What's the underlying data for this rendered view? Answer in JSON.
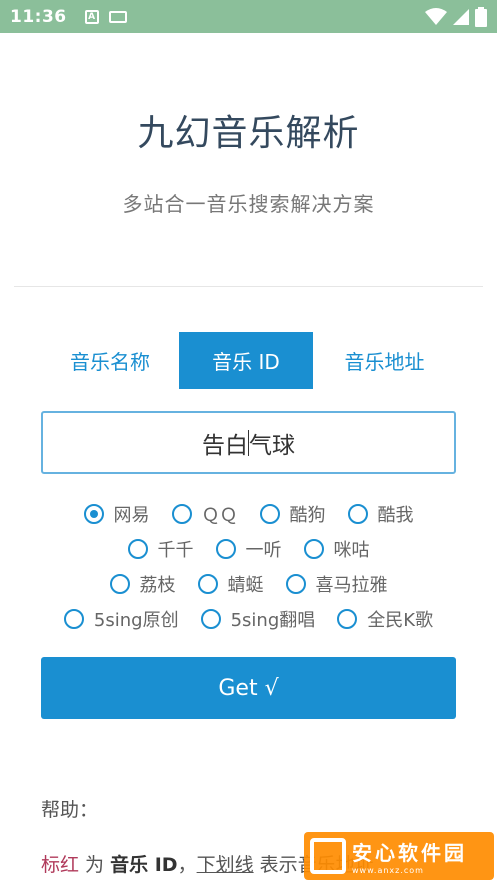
{
  "status_bar": {
    "time": "11:36",
    "a_icon": "A"
  },
  "header": {
    "title": "九幻音乐解析",
    "subtitle": "多站合一音乐搜索解决方案"
  },
  "tabs": [
    {
      "label": "音乐名称",
      "active": false
    },
    {
      "label": "音乐 ID",
      "active": true
    },
    {
      "label": "音乐地址",
      "active": false
    }
  ],
  "search": {
    "value_before_caret": "告白",
    "value_after_caret": "气球"
  },
  "sources": [
    {
      "label": "网易",
      "checked": true
    },
    {
      "label": "ＱＱ",
      "checked": false
    },
    {
      "label": "酷狗",
      "checked": false
    },
    {
      "label": "酷我",
      "checked": false
    },
    {
      "label": "千千",
      "checked": false
    },
    {
      "label": "一听",
      "checked": false
    },
    {
      "label": "咪咕",
      "checked": false
    },
    {
      "label": "荔枝",
      "checked": false
    },
    {
      "label": "蜻蜓",
      "checked": false
    },
    {
      "label": "喜马拉雅",
      "checked": false
    },
    {
      "label": "5sing原创",
      "checked": false
    },
    {
      "label": "5sing翻唱",
      "checked": false
    },
    {
      "label": "全民K歌",
      "checked": false
    }
  ],
  "get_button": {
    "label": "Get √"
  },
  "help": {
    "title": "帮助：",
    "red_text": "标红",
    "text_1": " 为 ",
    "bold_text": "音乐 ID",
    "text_2": "，",
    "underline_text": "下划线",
    "text_3": " 表示音乐地址"
  },
  "watermark": {
    "text": "安心软件园",
    "subtext": "www.anxz.com"
  },
  "colors": {
    "accent": "#1a8fd1",
    "status_bar": "#8bbf9a",
    "title": "#34495e",
    "red": "#b03a5b",
    "watermark": "#ff8c00"
  }
}
